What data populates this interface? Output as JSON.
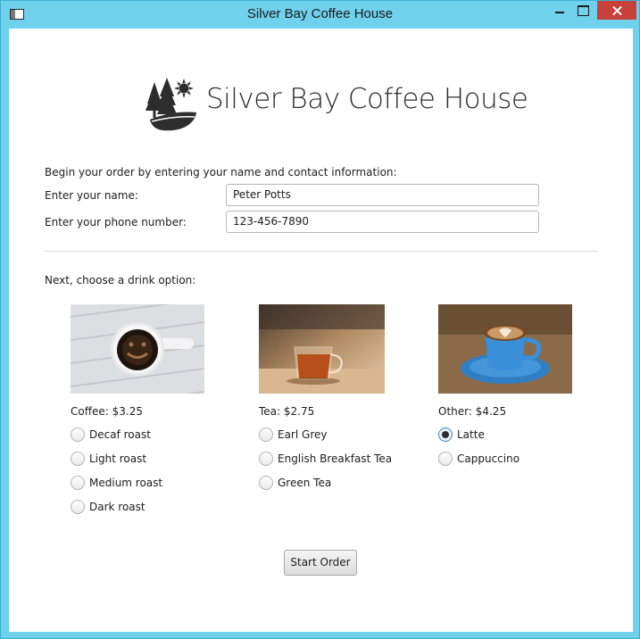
{
  "window": {
    "title": "Silver Bay Coffee House"
  },
  "logo": {
    "text": "Silver Bay Coffee House",
    "icon": "trees-sun-wave-logo",
    "color": "#2d2d2d"
  },
  "contact": {
    "intro": "Begin your order by entering your name and contact information:",
    "name_label": "Enter your name:",
    "name_value": "Peter Potts",
    "phone_label": "Enter your phone number:",
    "phone_value": "123-456-7890"
  },
  "drinks": {
    "prompt": "Next, choose a drink option:",
    "groups": [
      {
        "heading": "Coffee: $3.25",
        "image": "coffee-cup-photo",
        "options": [
          {
            "label": "Decaf roast",
            "selected": false
          },
          {
            "label": "Light roast",
            "selected": false
          },
          {
            "label": "Medium roast",
            "selected": false
          },
          {
            "label": "Dark roast",
            "selected": false
          }
        ]
      },
      {
        "heading": "Tea: $2.75",
        "image": "tea-glass-photo",
        "options": [
          {
            "label": "Earl Grey",
            "selected": false
          },
          {
            "label": "English Breakfast Tea",
            "selected": false
          },
          {
            "label": "Green Tea",
            "selected": false
          }
        ]
      },
      {
        "heading": "Other: $4.25",
        "image": "latte-art-photo",
        "options": [
          {
            "label": "Latte",
            "selected": true
          },
          {
            "label": "Cappuccino",
            "selected": false
          }
        ]
      }
    ]
  },
  "actions": {
    "start_label": "Start Order"
  },
  "colors": {
    "titlebar": "#6fd1ec",
    "close_button": "#c7403a",
    "radio_selected_border": "#3b86c8"
  }
}
